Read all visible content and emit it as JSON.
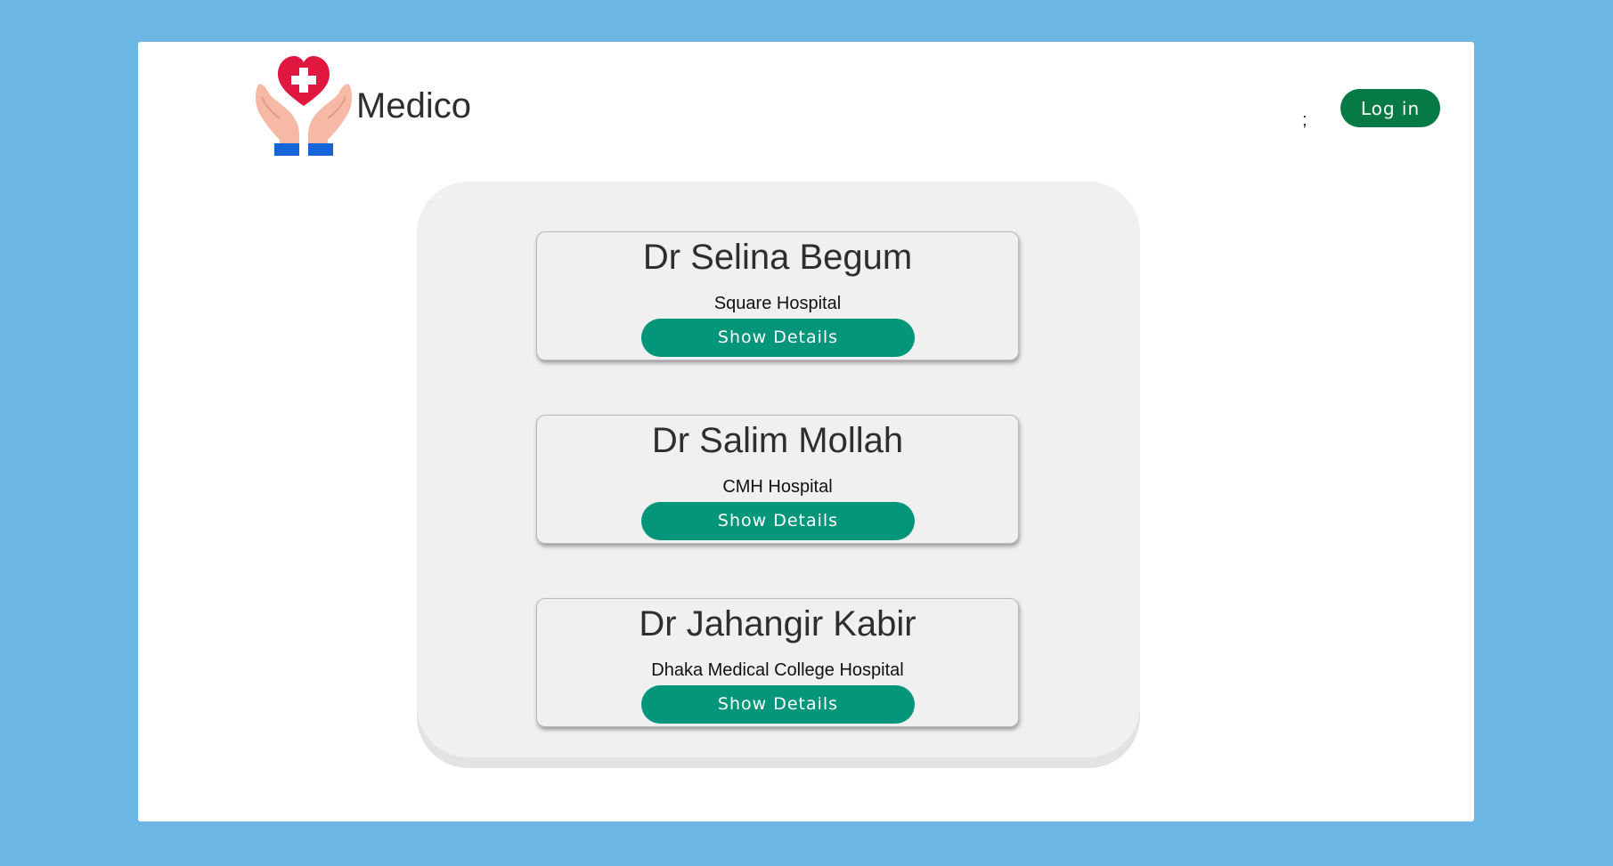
{
  "header": {
    "brand_name": "Medico",
    "logo_icon": "heart-hands-icon",
    "separator_text": ";",
    "login_label": "Log in"
  },
  "colors": {
    "background": "#6bb6e2",
    "login_button": "#067a44",
    "details_button": "#03967a",
    "panel": "#f0f0f0"
  },
  "doctors": [
    {
      "name": "Dr Selina Begum",
      "hospital": "Square Hospital",
      "button_label": "Show Details"
    },
    {
      "name": "Dr Salim Mollah",
      "hospital": "CMH Hospital",
      "button_label": "Show Details"
    },
    {
      "name": "Dr Jahangir Kabir",
      "hospital": "Dhaka Medical College Hospital",
      "button_label": "Show Details"
    }
  ]
}
